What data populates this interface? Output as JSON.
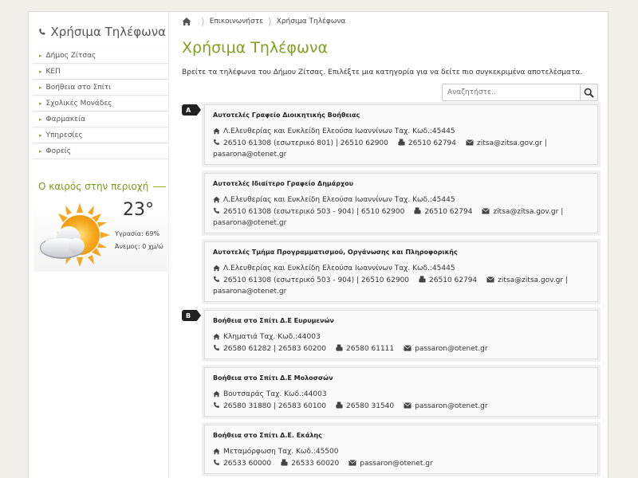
{
  "sidebar": {
    "title": "Χρήσιμα Τηλέφωνα",
    "items": [
      {
        "label": "Δήμος Ζίτσας"
      },
      {
        "label": "ΚΕΠ"
      },
      {
        "label": "Βοήθεια στο Σπίτι"
      },
      {
        "label": "Σχολικές Μονάδες"
      },
      {
        "label": "Φαρμακεία"
      },
      {
        "label": "Υπηρεσίες"
      },
      {
        "label": "Φορείς"
      }
    ],
    "weather": {
      "title": "Ο καιρός στην περιοχή",
      "temperature": "23°",
      "humidity": "Υγρασία: 69%",
      "wind": "Άνεμος: 0 χμ/ώ",
      "icon": "partly-cloudy-sun-icon"
    }
  },
  "breadcrumb": {
    "home_icon": "home-icon",
    "items": [
      "Επικοινωνήστε",
      "Χρήσιμα Τηλέφωνα"
    ]
  },
  "page": {
    "title": "Χρήσιμα Τηλέφωνα",
    "intro": "Βρείτε τα τηλέφωνα του Δήμου Ζίτσας. Επιλέξτε μια κατηγορία για να δείτε πιο συγκεκριμένα αποτελέσματα."
  },
  "search": {
    "placeholder": "Αναζητήστε..",
    "icon": "search-icon"
  },
  "groups": [
    {
      "letter": "A",
      "entries": [
        {
          "name": "Αυτοτελές Γραφείο Διοικητικής Βοήθειας",
          "address": "Λ.Ελευθερίας και Ευκλείδη Ελεούσα Ιωαννίνων Ταχ. Κωδ.:45445",
          "phone": "26510 61308 (εσωτερικό 801) | 26510 62900",
          "fax": "26510 62794",
          "email": "zitsa@zitsa.gov.gr |",
          "email2": "pasarona@otenet.gr"
        },
        {
          "name": "Αυτοτελές Ιδιαίτερο Γραφείο Δημάρχου",
          "address": "Λ.Ελευθερίας και Ευκλείδη Ελεούσα Ιωαννίνων Ταχ. Κωδ.:45445",
          "phone": "26510 61308 (εσωτερικό 503 - 904) | 6510 62900",
          "fax": "26510 62794",
          "email": "zitsa@zitsa.gov.gr |",
          "email2": "pasarona@otenet.gr"
        },
        {
          "name": "Αυτοτελές Τμήμα Προγραμματισμού, Οργάνωσης και Πληροφορικής",
          "address": "Λ.Ελευθερίας και Ευκλείδη Ελεούσα Ιωαννίνων Ταχ. Κωδ.:45445",
          "phone": "26510 61308 (εσωτερικό 503 - 904) | 26510 62900",
          "fax": "26510 62794",
          "email": "zitsa@zitsa.gov.gr |",
          "email2": "pasarona@otenet.gr"
        }
      ]
    },
    {
      "letter": "B",
      "entries": [
        {
          "name": "Βοήθεια στο Σπίτι Δ.Ε Ευρυμενών",
          "address": "Κληματιά Ταχ. Κωδ.:44003",
          "phone": "26580 61282 | 26583 60200",
          "fax": "26580 61111",
          "email": "passaron@otenet.gr"
        },
        {
          "name": "Βοήθεια στο Σπίτι Δ.Ε Μολοσσών",
          "address": "Βουτσαράς Ταχ. Κωδ.:44003",
          "phone": "26580 31880 | 26583 60100",
          "fax": "26580 31540",
          "email": "passaron@otenet.gr"
        },
        {
          "name": "Βοήθεια στο Σπίτι Δ.Ε. Εκάλης",
          "address": "Μεταμόρφωση Ταχ. Κωδ.:45500",
          "phone": "26533 60000",
          "fax": "26533 60020",
          "email": "passaron@otenet.gr"
        }
      ]
    }
  ],
  "colors": {
    "accent_green": "#7fa021",
    "background": "#f1efe9",
    "badge": "#222222"
  }
}
